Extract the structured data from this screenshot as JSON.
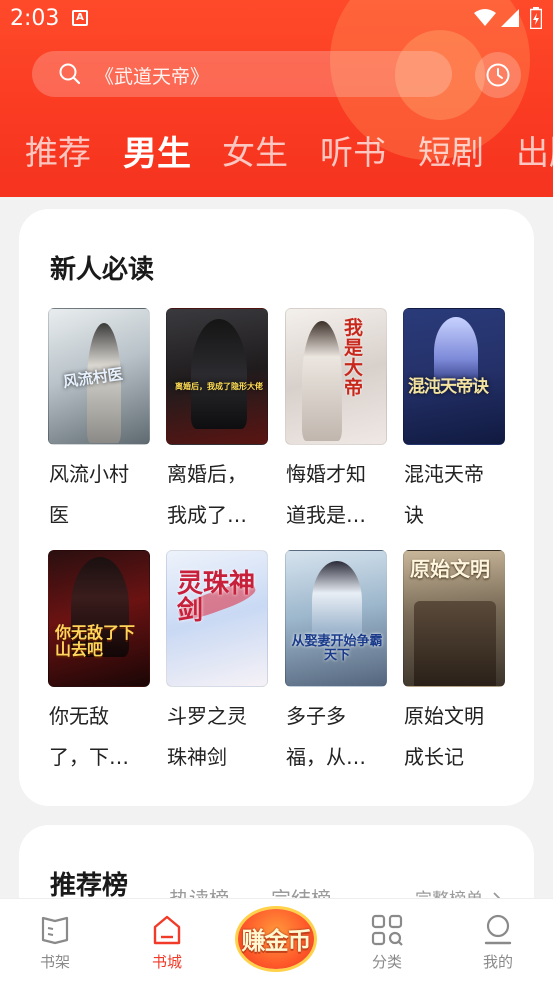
{
  "status_bar": {
    "time": "2:03",
    "notification_icon": "A"
  },
  "search": {
    "placeholder": "《武道天帝》"
  },
  "tabs": [
    {
      "label": "推荐",
      "active": false
    },
    {
      "label": "男生",
      "active": true
    },
    {
      "label": "女生",
      "active": false
    },
    {
      "label": "听书",
      "active": false
    },
    {
      "label": "短剧",
      "active": false
    },
    {
      "label": "出版",
      "active": false
    }
  ],
  "new_reader_section": {
    "title": "新人必读",
    "books": [
      {
        "title_line1": "风流小村",
        "title_line2": "医",
        "cover_text": "风流村医"
      },
      {
        "title_line1": "离婚后，",
        "title_line2": "我成了…",
        "cover_text": "离婚后，我成了隐形大佬"
      },
      {
        "title_line1": "悔婚才知",
        "title_line2": "道我是…",
        "cover_text": "我是大帝"
      },
      {
        "title_line1": "混沌天帝",
        "title_line2": "诀",
        "cover_text": "混沌天帝诀"
      },
      {
        "title_line1": "你无敌",
        "title_line2": "了，下…",
        "cover_text": "你无敌了下山去吧"
      },
      {
        "title_line1": "斗罗之灵",
        "title_line2": "珠神剑",
        "cover_text": "灵珠神剑"
      },
      {
        "title_line1": "多子多",
        "title_line2": "福，从…",
        "cover_text": "从娶妻开始争霸天下"
      },
      {
        "title_line1": "原始文明",
        "title_line2": "成长记",
        "cover_text": "原始文明"
      }
    ]
  },
  "ranking_section": {
    "title": "推荐榜",
    "tabs": [
      "热读榜",
      "完结榜"
    ],
    "full_list_link": "完整榜单"
  },
  "bottom_nav": {
    "items": [
      {
        "label": "书架",
        "icon": "bookshelf-icon",
        "active": false
      },
      {
        "label": "书城",
        "icon": "bookstore-icon",
        "active": true
      },
      {
        "label": "分类",
        "icon": "category-icon",
        "active": false
      },
      {
        "label": "我的",
        "icon": "profile-icon",
        "active": false
      }
    ],
    "coin_button": "赚金币"
  },
  "colors": {
    "accent": "#f23a28",
    "header": "#fa3a22"
  }
}
